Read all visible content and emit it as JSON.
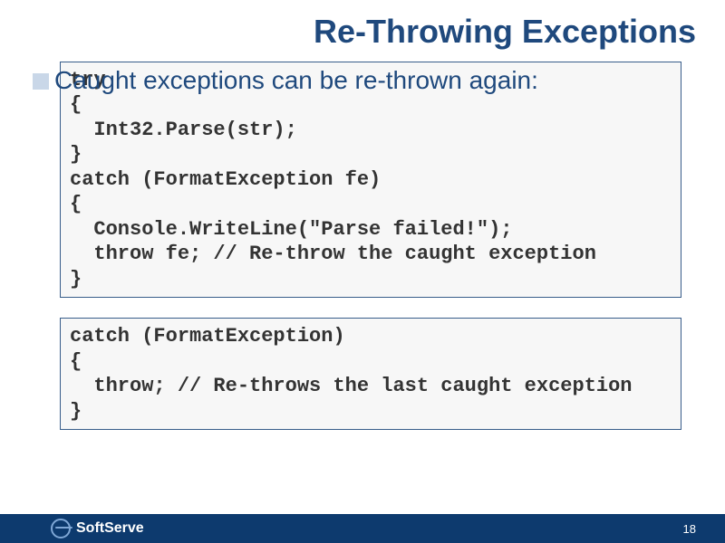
{
  "title": "Re-Throwing Exceptions",
  "bullet": "Caught exceptions can be re-thrown again:",
  "code1": "try\n{\n  Int32.Parse(str);\n}\ncatch (FormatException fe)\n{\n  Console.WriteLine(\"Parse failed!\");\n  throw fe; // Re-throw the caught exception\n}",
  "code2": "catch (FormatException)\n{\n  throw; // Re-throws the last caught exception\n}",
  "brand": "SoftServe",
  "page": "18"
}
